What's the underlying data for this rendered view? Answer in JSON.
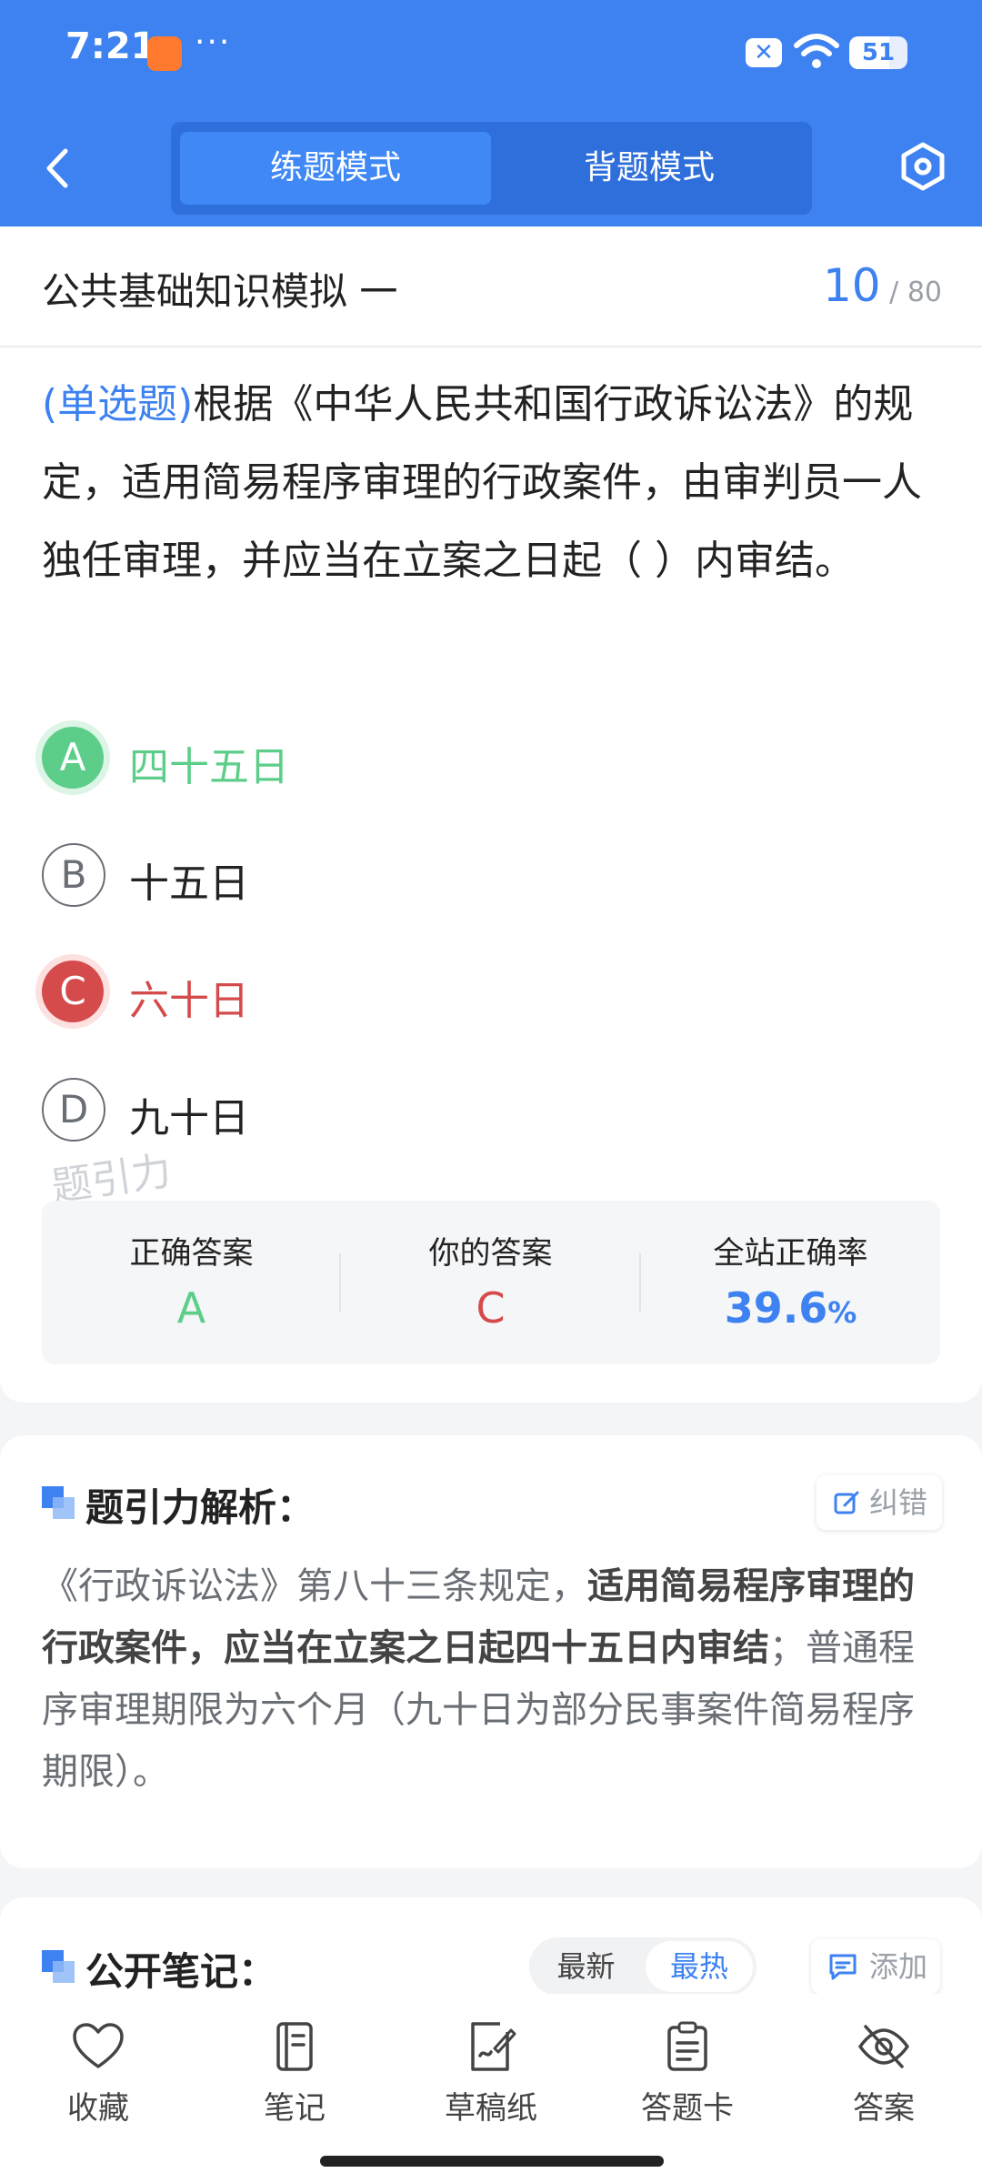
{
  "status_bar": {
    "time": "7:21",
    "dots": "···",
    "x_badge": "✕",
    "battery": "51"
  },
  "header": {
    "modes": [
      {
        "label": "练题模式",
        "active": true
      },
      {
        "label": "背题模式",
        "active": false
      }
    ]
  },
  "question": {
    "paper_title": "公共基础知识模拟 一",
    "current": "10",
    "separator": "/",
    "total": "80",
    "type": "(单选题)",
    "stem": "根据《中华人民共和国行政诉讼法》的规定，适用简易程序审理的行政案件，由审判员一人独任审理，并应当在立案之日起（    ）内审结。",
    "options": [
      {
        "letter": "A",
        "text": "四十五日",
        "state": "correct"
      },
      {
        "letter": "B",
        "text": "十五日",
        "state": "normal"
      },
      {
        "letter": "C",
        "text": "六十日",
        "state": "wrong"
      },
      {
        "letter": "D",
        "text": "九十日",
        "state": "normal"
      }
    ],
    "watermark": "题引力"
  },
  "stats": {
    "correct_label": "正确答案",
    "correct_value": "A",
    "yours_label": "你的答案",
    "yours_value": "C",
    "rate_label": "全站正确率",
    "rate_value": "39.6",
    "rate_unit": "%"
  },
  "analysis": {
    "title": "题引力解析：",
    "report_label": "纠错",
    "text_1": "《行政诉讼法》第八十三条规定，",
    "text_bold": "适用简易程序审理的行政案件，应当在立案之日起四十五日内审结",
    "text_2": "；普通程序审理期限为六个月（九十日为部分民事案件简易程序期限）。"
  },
  "notes": {
    "title": "公开笔记：",
    "sort_new": "最新",
    "sort_hot": "最热",
    "add_label": "添加"
  },
  "bottom_nav": [
    {
      "label": "收藏"
    },
    {
      "label": "笔记"
    },
    {
      "label": "草稿纸"
    },
    {
      "label": "答题卡"
    },
    {
      "label": "答案"
    }
  ],
  "colors": {
    "primary": "#3d82f0",
    "correct": "#5dce8a",
    "wrong": "#d54b4b"
  }
}
